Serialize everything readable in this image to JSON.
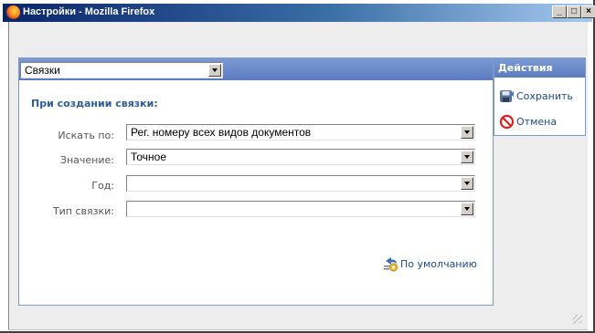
{
  "window": {
    "title": "Настройки - Mozilla Firefox",
    "icon": "firefox-icon",
    "minimize_label": "_",
    "maximize_label": "□",
    "close_label": "×"
  },
  "type_select": {
    "value": "Связки",
    "options": [
      "Связки"
    ]
  },
  "form": {
    "section_title": "При создании связки:",
    "fields": [
      {
        "label": "Искать по:",
        "value": "Рег. номеру всех видов документов"
      },
      {
        "label": "Значение:",
        "value": "Точное"
      },
      {
        "label": "Год:",
        "value": ""
      },
      {
        "label": "Тип связки:",
        "value": ""
      }
    ],
    "defaults_label": "По умолчанию"
  },
  "actions": {
    "title": "Действия",
    "items": [
      {
        "label": "Сохранить",
        "icon": "save-icon"
      },
      {
        "label": "Отмена",
        "icon": "cancel-icon"
      }
    ]
  },
  "colors": {
    "title_bar": "#0a246a",
    "panel_header": "#6b8acb",
    "section_title": "#2e5c99",
    "link": "#1d4a8a",
    "cancel_icon": "#e02020"
  }
}
